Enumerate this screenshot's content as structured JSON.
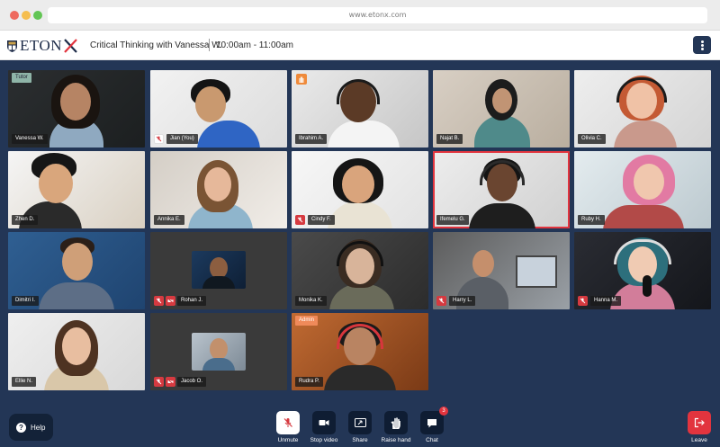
{
  "browser": {
    "url": "www.etonx.com"
  },
  "header": {
    "logo_text": "ETON",
    "title": "Critical Thinking with Vanessa W.",
    "time": "10:00am - 11:00am"
  },
  "participants": [
    {
      "name": "Vanessa W.",
      "badge": "Tutor"
    },
    {
      "name": "Jian (You)"
    },
    {
      "name": "Ibrahim A."
    },
    {
      "name": "Najat B."
    },
    {
      "name": "Olivia C."
    },
    {
      "name": "Zhen D."
    },
    {
      "name": "Annika E."
    },
    {
      "name": "Cindy F."
    },
    {
      "name": "Ifemelu G."
    },
    {
      "name": "Ruby H."
    },
    {
      "name": "Dimitri I."
    },
    {
      "name": "Rohan J."
    },
    {
      "name": "Monika K."
    },
    {
      "name": "Harry L."
    },
    {
      "name": "Hanna M."
    },
    {
      "name": "Ellie N."
    },
    {
      "name": "Jacob O."
    },
    {
      "name": "Rudra P.",
      "badge": "Admin"
    }
  ],
  "toolbar": {
    "help": "Help",
    "unmute": "Unmute",
    "stop_video": "Stop video",
    "share": "Share",
    "raise_hand": "Raise hand",
    "chat": "Chat",
    "chat_count": "3",
    "leave": "Leave"
  },
  "colors": {
    "stage": "#233656",
    "accent_red": "#e2343e",
    "hand_orange": "#ef8a3a"
  }
}
